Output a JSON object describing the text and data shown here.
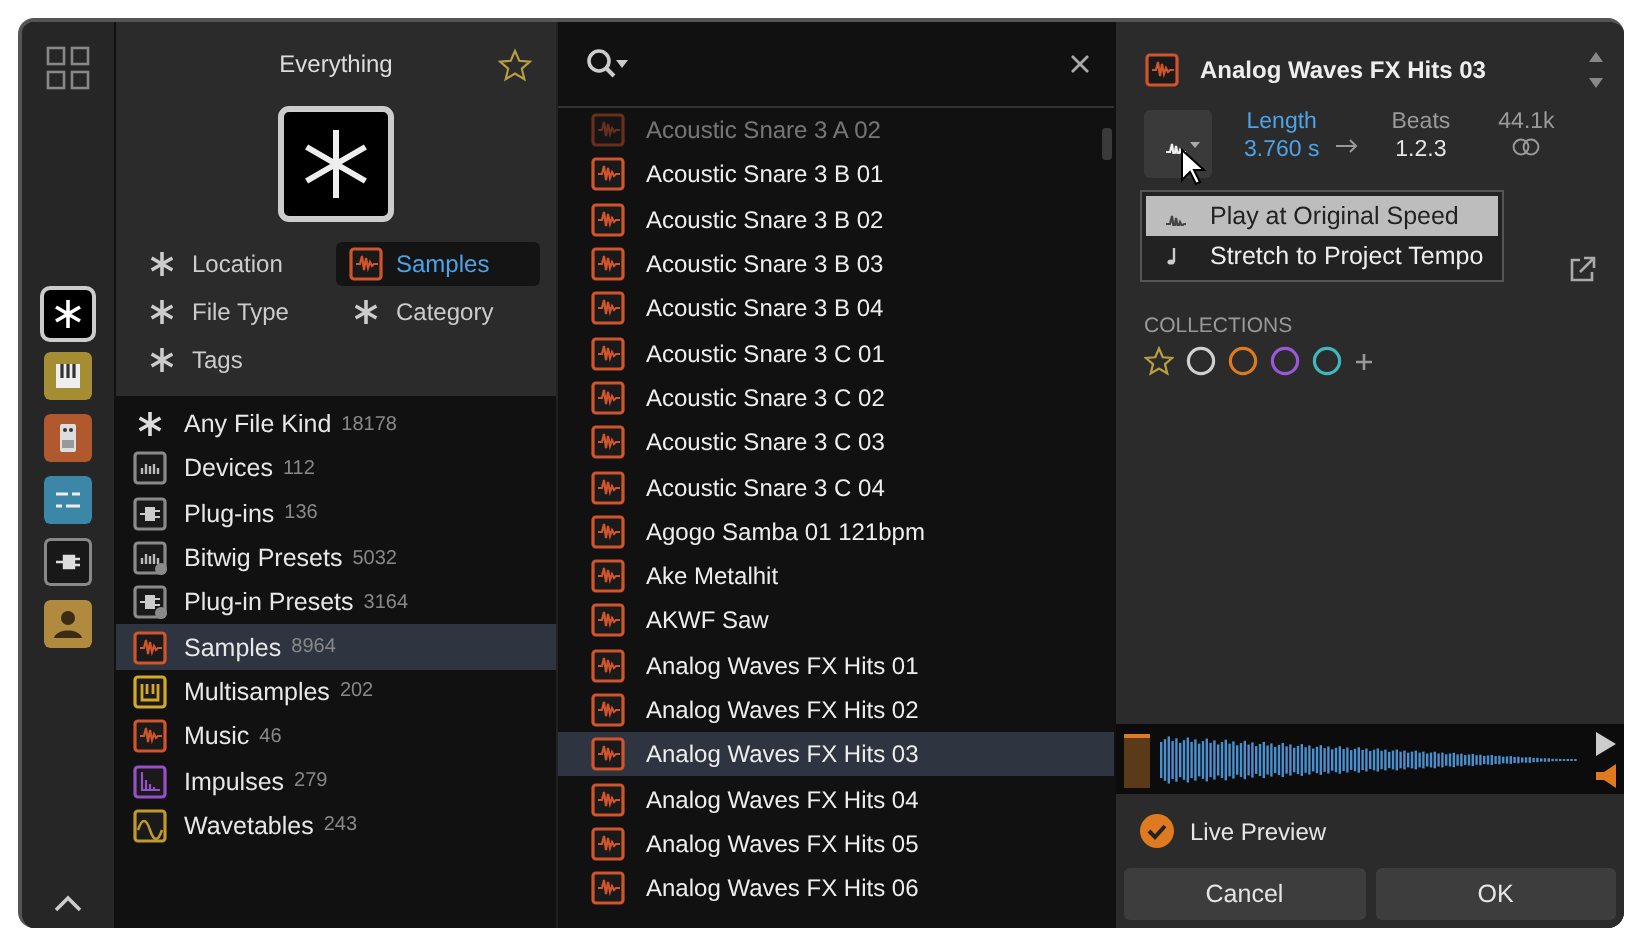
{
  "rail": {
    "items": [
      {
        "kind": "all",
        "color": "#000000",
        "selected": true
      },
      {
        "kind": "instrument",
        "color": "#a58d33",
        "selected": false
      },
      {
        "kind": "effect",
        "color": "#b0582e",
        "selected": false
      },
      {
        "kind": "modulator",
        "color": "#3c86a8",
        "selected": false
      },
      {
        "kind": "plugin",
        "color": "#181818",
        "selected": false
      },
      {
        "kind": "user",
        "color": "#b08a3e",
        "selected": false
      }
    ]
  },
  "filters": {
    "title": "Everything",
    "chips": [
      {
        "label": "Location",
        "kind": "any",
        "selected": false
      },
      {
        "label": "Samples",
        "kind": "sample",
        "selected": true
      },
      {
        "label": "File Type",
        "kind": "any",
        "selected": false
      },
      {
        "label": "Category",
        "kind": "any",
        "selected": false
      },
      {
        "label": "Tags",
        "kind": "any",
        "selected": false
      }
    ],
    "file_kinds": [
      {
        "label": "Any File Kind",
        "count": "18178",
        "kind": "any",
        "color": "#dddddd",
        "selected": false
      },
      {
        "label": "Devices",
        "count": "112",
        "kind": "device",
        "color": "#8a8a8a",
        "selected": false
      },
      {
        "label": "Plug-ins",
        "count": "136",
        "kind": "plugin",
        "color": "#8a8a8a",
        "selected": false
      },
      {
        "label": "Bitwig Presets",
        "count": "5032",
        "kind": "device-preset",
        "color": "#8a8a8a",
        "selected": false
      },
      {
        "label": "Plug-in Presets",
        "count": "3164",
        "kind": "plugin-preset",
        "color": "#8a8a8a",
        "selected": false
      },
      {
        "label": "Samples",
        "count": "8964",
        "kind": "sample",
        "color": "#d0552b",
        "selected": true
      },
      {
        "label": "Multisamples",
        "count": "202",
        "kind": "multisample",
        "color": "#d4a82a",
        "selected": false
      },
      {
        "label": "Music",
        "count": "46",
        "kind": "sample",
        "color": "#d0552b",
        "selected": false
      },
      {
        "label": "Impulses",
        "count": "279",
        "kind": "impulse",
        "color": "#9650c8",
        "selected": false
      },
      {
        "label": "Wavetables",
        "count": "243",
        "kind": "wavetable",
        "color": "#c09a2a",
        "selected": false
      }
    ]
  },
  "results": {
    "rows": [
      {
        "name": "Acoustic Snare 3 A 02",
        "partial": true,
        "selected": false
      },
      {
        "name": "Acoustic Snare 3 B 01",
        "partial": false,
        "selected": false
      },
      {
        "name": "Acoustic Snare 3 B 02",
        "partial": false,
        "selected": false
      },
      {
        "name": "Acoustic Snare 3 B 03",
        "partial": false,
        "selected": false
      },
      {
        "name": "Acoustic Snare 3 B 04",
        "partial": false,
        "selected": false
      },
      {
        "name": "Acoustic Snare 3 C 01",
        "partial": false,
        "selected": false
      },
      {
        "name": "Acoustic Snare 3 C 02",
        "partial": false,
        "selected": false
      },
      {
        "name": "Acoustic Snare 3 C 03",
        "partial": false,
        "selected": false
      },
      {
        "name": "Acoustic Snare 3 C 04",
        "partial": false,
        "selected": false
      },
      {
        "name": "Agogo Samba 01 121bpm",
        "partial": false,
        "selected": false
      },
      {
        "name": "Ake Metalhit",
        "partial": false,
        "selected": false
      },
      {
        "name": "AKWF Saw",
        "partial": false,
        "selected": false
      },
      {
        "name": "Analog Waves FX Hits 01",
        "partial": false,
        "selected": false
      },
      {
        "name": "Analog Waves FX Hits 02",
        "partial": false,
        "selected": false
      },
      {
        "name": "Analog Waves FX Hits 03",
        "partial": false,
        "selected": true
      },
      {
        "name": "Analog Waves FX Hits 04",
        "partial": false,
        "selected": false
      },
      {
        "name": "Analog Waves FX Hits 05",
        "partial": false,
        "selected": false
      },
      {
        "name": "Analog Waves FX Hits 06",
        "partial": false,
        "selected": false
      }
    ]
  },
  "preview": {
    "title": "Analog Waves FX Hits 03",
    "length_label": "Length",
    "length": "3.760 s",
    "beats_label": "Beats",
    "beats": "1.2.3",
    "rate": "44.1k",
    "menu": [
      {
        "label": "Play at Original Speed",
        "kind": "original",
        "selected": true
      },
      {
        "label": "Stretch to Project Tempo",
        "kind": "stretch",
        "selected": false
      }
    ],
    "collections_label": "COLLECTIONS",
    "collections": [
      {
        "kind": "star",
        "color": "#b8a040"
      },
      {
        "kind": "circle",
        "color": "#d0d0d0"
      },
      {
        "kind": "circle",
        "color": "#e07a20"
      },
      {
        "kind": "circle",
        "color": "#9a5ad8"
      },
      {
        "kind": "circle",
        "color": "#40b8c0"
      }
    ],
    "live_preview": {
      "label": "Live Preview",
      "checked": true
    },
    "buttons": [
      "Cancel",
      "OK"
    ]
  }
}
